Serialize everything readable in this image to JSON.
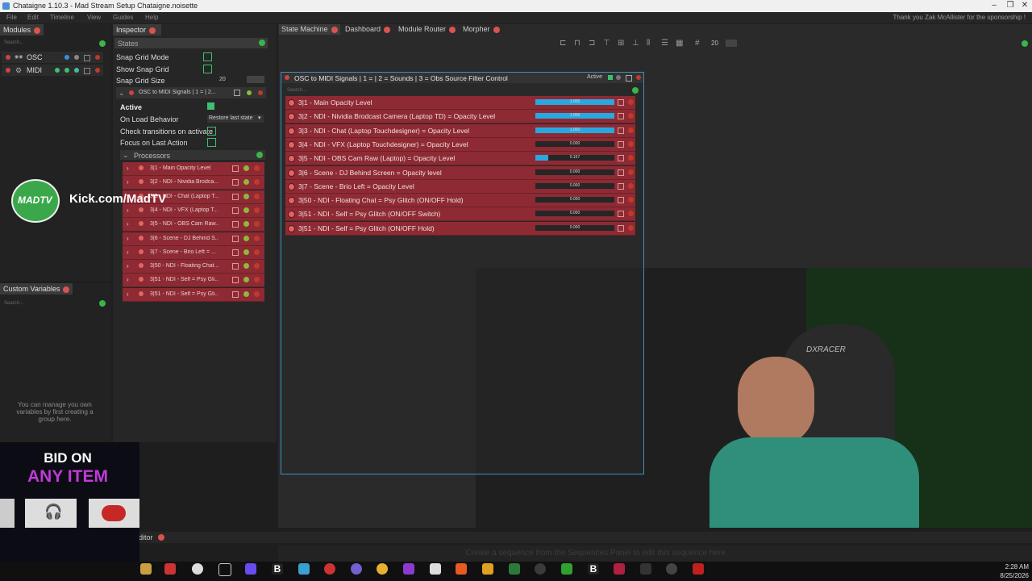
{
  "window": {
    "title": "Chataigne 1.10.3 - Mad Stream Setup Chataigne.noisette"
  },
  "menu": [
    "File",
    "Edit",
    "Timeline",
    "View",
    "Guides",
    "Help"
  ],
  "sponsor_text": "Thank you Zak McAllister for the sponsorship !",
  "modules": {
    "title": "Modules",
    "search": "Search...",
    "items": [
      {
        "name": "OSC"
      },
      {
        "name": "MIDI"
      }
    ]
  },
  "custom_vars": {
    "title": "Custom Variables",
    "search": "Search...",
    "hint": "You can manage you own variables by first creating a group here."
  },
  "inspector": {
    "title": "Inspector",
    "states_label": "States",
    "snap_grid_mode": "Snap Grid Mode",
    "show_snap_grid": "Show Snap Grid",
    "snap_grid_size_label": "Snap Grid Size",
    "snap_grid_size_value": "20",
    "state_name": "OSC to MIDI Signals | 1 = | 2...",
    "active_label": "Active",
    "on_load_label": "On Load Behavior",
    "on_load_value": "Restore last state",
    "check_transitions": "Check transitions on activate",
    "focus_last": "Focus on Last Action",
    "processors_label": "Processors",
    "processors": [
      "3|1 - Main Opacity Level",
      "3|2 - NDI - Nividia Brodca...",
      "3|3 - NDI - Chat (Laptop T...",
      "3|4 - NDI - VFX (Laptop T...",
      "3|5 - NDI - OBS Cam Raw...",
      "3|6 - Scene - DJ Behind S...",
      "3|7 - Scene - Brio Left = ...",
      "3|50 - NDI - Floating Chat...",
      "3|51 - NDI - Self = Psy Gli...",
      "3|51 - NDI - Self = Psy Gli..."
    ]
  },
  "tabs": [
    {
      "label": "State Machine"
    },
    {
      "label": "Dashboard"
    },
    {
      "label": "Module Router"
    },
    {
      "label": "Morpher"
    }
  ],
  "toolbar": {
    "grid_size": "20"
  },
  "state_node": {
    "title": "OSC to MIDI Signals | 1 =  | 2 = Sounds | 3 = Obs Source Filter Control",
    "active_label": "Active",
    "search": "Search...",
    "rows": [
      {
        "label": "3|1 - Main Opacity Level",
        "value": "1.000",
        "level": 1.0
      },
      {
        "label": "3|2 - NDI - Nividia Brodcast Camera (Laptop TD) = Opacity Level",
        "value": "1.000",
        "level": 1.0
      },
      {
        "label": "3|3 - NDI - Chat (Laptop Touchdesigner) = Opacity Level",
        "value": "1.000",
        "level": 1.0
      },
      {
        "label": "3|4 - NDI - VFX (Laptop Touchdesigner) = Opacity Level",
        "value": "0.000",
        "level": 0
      },
      {
        "label": "3|5 - NDI - OBS Cam Raw (Laptop) = Opacity Level",
        "value": "0.167",
        "level": 0.167
      },
      {
        "label": "3|6 - Scene - DJ Behind Screen = Opacity level",
        "value": "0.000",
        "level": 0
      },
      {
        "label": "3|7 - Scene - Brio Left = Opacity Level",
        "value": "0.000",
        "level": 0
      },
      {
        "label": "3|50 - NDI - Floating Chat = Psy Glitch (ON/OFF Hold)",
        "value": "0.000",
        "level": 0
      },
      {
        "label": "3|51 - NDI - Self = Psy Glitch (ON/OFF Switch)",
        "value": "0.000",
        "level": 0
      },
      {
        "label": "3|51 - NDI - Self = Psy Glitch (ON/OFF Hold)",
        "value": "0.000",
        "level": 0
      }
    ]
  },
  "sequence_hint": "Create a sequence from the Sequences Panel to edit this sequence here.",
  "editor_tab": "ditor",
  "overlay": {
    "kick": "Kick.com/MadTV",
    "logo_text": "MADTV",
    "bid_line1": "BID ON",
    "bid_line2": "ANY ITEM"
  },
  "clock": {
    "time": "2:28 AM",
    "date": "8/25/2026"
  },
  "colors": {
    "row_red": "#8e2a33",
    "accent_blue": "#29a8e0",
    "green": "#39b54a"
  }
}
